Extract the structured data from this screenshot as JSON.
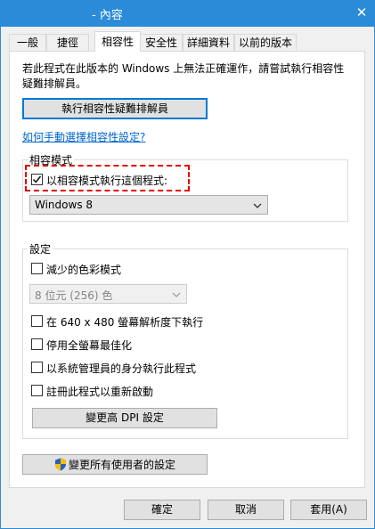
{
  "window": {
    "title": "- 內容",
    "close_glyph": "✕"
  },
  "tabs": [
    {
      "label": "一般"
    },
    {
      "label": "捷徑"
    },
    {
      "label": "相容性",
      "active": true
    },
    {
      "label": "安全性"
    },
    {
      "label": "詳細資料"
    },
    {
      "label": "以前的版本"
    }
  ],
  "compat": {
    "description": "若此程式在此版本的 Windows 上無法正確運作，請嘗試執行相容性疑難排解員。",
    "troubleshooter_button": "執行相容性疑難排解員",
    "manual_link": "如何手動選擇相容性設定?",
    "mode_group": {
      "title": "相容模式",
      "checkbox_label": "以相容模式執行這個程式:",
      "checked": true,
      "selected_os": "Windows 8"
    },
    "settings_group": {
      "title": "設定",
      "reduced_color": {
        "label": "減少的色彩模式",
        "checked": false
      },
      "color_select": "8 位元 (256) 色",
      "res640": {
        "label": "在 640 x 480 螢幕解析度下執行",
        "checked": false
      },
      "fullscreen": {
        "label": "停用全螢幕最佳化",
        "checked": false
      },
      "admin": {
        "label": "以系統管理員的身分執行此程式",
        "checked": false
      },
      "restart": {
        "label": "註冊此程式以重新啟動",
        "checked": false
      },
      "dpi_button": "變更高 DPI 設定"
    },
    "all_users_button": "變更所有使用者的設定"
  },
  "footer": {
    "ok": "確定",
    "cancel": "取消",
    "apply": "套用(A)"
  },
  "colors": {
    "titlebar": "#2b8bd8",
    "highlight": "#e00000",
    "link": "#0066cc",
    "shield_blue": "#2a5fb8",
    "shield_yellow": "#f2c200"
  },
  "icons": {
    "check": "check-icon",
    "chevron": "chevron-down-icon",
    "shield": "shield-icon",
    "close": "close-icon"
  }
}
